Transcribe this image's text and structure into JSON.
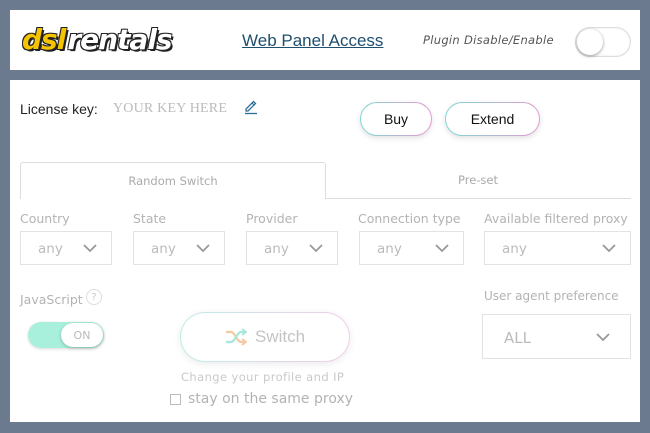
{
  "header": {
    "logo": {
      "part1": "dsl",
      "part2": "rentals"
    },
    "web_panel_link": "Web Panel Access",
    "plugin_toggle_label": "Plugin Disable/Enable"
  },
  "license": {
    "label": "License key:",
    "value": "YOUR KEY HERE"
  },
  "actions": {
    "buy_label": "Buy",
    "extend_label": "Extend"
  },
  "tabs": [
    {
      "label": "Random Switch"
    },
    {
      "label": "Pre-set"
    }
  ],
  "filters": {
    "country": {
      "label": "Country",
      "value": "any"
    },
    "state": {
      "label": "State",
      "value": "any"
    },
    "provider": {
      "label": "Provider",
      "value": "any"
    },
    "connection_type": {
      "label": "Connection type",
      "value": "any"
    },
    "available_proxy": {
      "label": "Available filtered proxy",
      "value": "any"
    }
  },
  "javascript": {
    "label": "JavaScript",
    "help": "?",
    "toggle_text": "ON"
  },
  "switch": {
    "label": "Switch",
    "hint": "Change your profile and IP"
  },
  "stay_same_proxy": {
    "label": "stay on the same proxy"
  },
  "user_agent": {
    "label": "User agent preference",
    "value": "ALL"
  }
}
